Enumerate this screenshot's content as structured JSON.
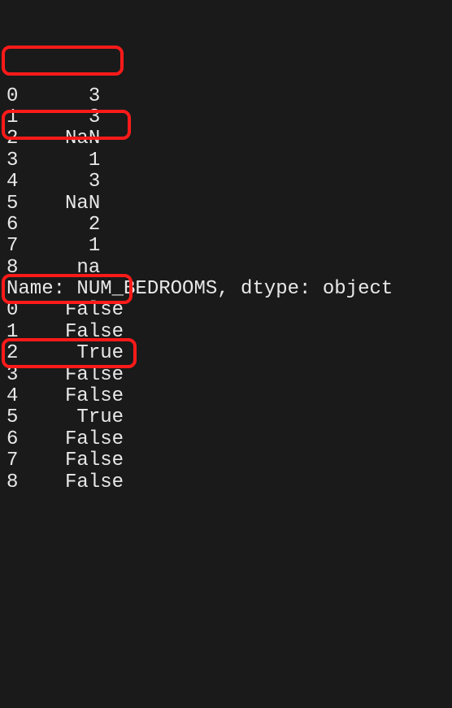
{
  "series1": {
    "rows": [
      {
        "idx": "0",
        "val": "3"
      },
      {
        "idx": "1",
        "val": "3"
      },
      {
        "idx": "2",
        "val": "NaN"
      },
      {
        "idx": "3",
        "val": "1"
      },
      {
        "idx": "4",
        "val": "3"
      },
      {
        "idx": "5",
        "val": "NaN"
      },
      {
        "idx": "6",
        "val": "2"
      },
      {
        "idx": "7",
        "val": "1"
      },
      {
        "idx": "8",
        "val": "na"
      }
    ]
  },
  "series1_info": "Name: NUM_BEDROOMS, dtype: object",
  "series2": {
    "rows": [
      {
        "idx": "0",
        "val": "False"
      },
      {
        "idx": "1",
        "val": "False"
      },
      {
        "idx": "2",
        "val": "True"
      },
      {
        "idx": "3",
        "val": "False"
      },
      {
        "idx": "4",
        "val": "False"
      },
      {
        "idx": "5",
        "val": "True"
      },
      {
        "idx": "6",
        "val": "False"
      },
      {
        "idx": "7",
        "val": "False"
      },
      {
        "idx": "8",
        "val": "False"
      }
    ]
  }
}
